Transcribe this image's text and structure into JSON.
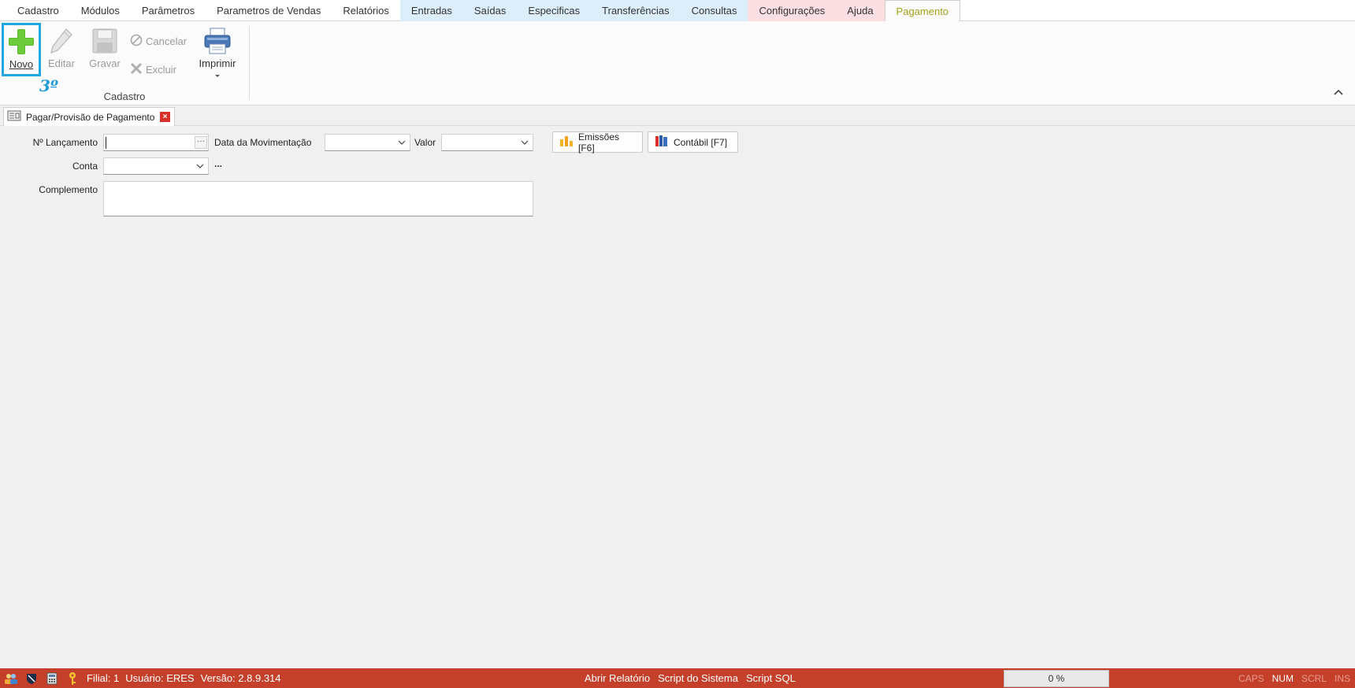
{
  "menu": {
    "tabs": [
      {
        "label": "Cadastro"
      },
      {
        "label": "Módulos"
      },
      {
        "label": "Parâmetros"
      },
      {
        "label": "Parametros de Vendas"
      },
      {
        "label": "Relatórios"
      },
      {
        "label": "Entradas"
      },
      {
        "label": "Saídas"
      },
      {
        "label": "Especificas"
      },
      {
        "label": "Transferências"
      },
      {
        "label": "Consultas"
      },
      {
        "label": "Configurações"
      },
      {
        "label": "Ajuda"
      },
      {
        "label": "Pagamento"
      }
    ],
    "active_tab": "Pagamento"
  },
  "ribbon": {
    "novo_label": "Novo",
    "editar_label": "Editar",
    "gravar_label": "Gravar",
    "cancelar_label": "Cancelar",
    "excluir_label": "Excluir",
    "imprimir_label": "Imprimir",
    "group_label": "Cadastro",
    "step_annotation": "3º"
  },
  "document_tab": {
    "title": "Pagar/Provisão de Pagamento"
  },
  "form": {
    "lancamento_label": "Nº Lançamento",
    "lancamento_value": "",
    "data_label": "Data da Movimentação",
    "data_value": "",
    "valor_label": "Valor",
    "valor_value": "",
    "emissoes_button": "Emissões [F6]",
    "contabil_button": "Contábil [F7]",
    "conta_label": "Conta",
    "conta_value": "",
    "conta_link": "...",
    "complemento_label": "Complemento",
    "complemento_value": ""
  },
  "statusbar": {
    "filial": "Filial: 1",
    "usuario": "Usuário: ERES",
    "versao": "Versão: 2.8.9.314",
    "abrir_relatorio": "Abrir Relatório",
    "script_sistema": "Script do Sistema",
    "script_sql": "Script SQL",
    "progress": "0 %",
    "caps": "CAPS",
    "num": "NUM",
    "scrl": "SCRL",
    "ins": "INS"
  },
  "colors": {
    "accent_blue": "#1ea7e1",
    "status_bar": "#c4402b",
    "active_tab_text": "#a3a21a"
  }
}
